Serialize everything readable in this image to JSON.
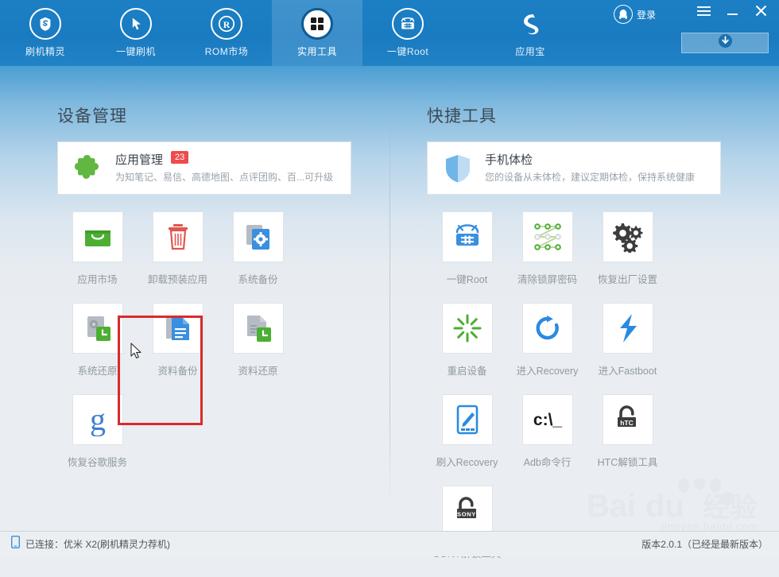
{
  "header": {
    "tabs": [
      {
        "label": "刷机精灵",
        "icon": "brand-s-icon",
        "active": false
      },
      {
        "label": "一键刷机",
        "icon": "cursor-arrow-icon",
        "active": false
      },
      {
        "label": "ROM市场",
        "icon": "registered-r-icon",
        "active": false
      },
      {
        "label": "实用工具",
        "icon": "grid-squares-icon",
        "active": true
      },
      {
        "label": "一键Root",
        "icon": "android-root-icon",
        "active": false
      },
      {
        "label": "应用宝",
        "icon": "yingyongbao-icon",
        "active": false
      }
    ],
    "login_label": "登录",
    "menu_icon": "hamburger-menu-icon",
    "minimize_icon": "minimize-icon",
    "close_icon": "close-icon",
    "download_icon": "download-arrow-icon",
    "accent_color": "#1a7bc0"
  },
  "left_panel": {
    "title": "设备管理",
    "feature_card": {
      "title": "应用管理",
      "badge": "23",
      "desc": "为知笔记、易信、高德地图、点评团购、百...可升级",
      "icon": "puzzle-piece-icon"
    },
    "tiles": [
      {
        "label": "应用市场",
        "icon": "shopping-bag-icon",
        "highlighted": false
      },
      {
        "label": "卸载预装应用",
        "icon": "trash-can-icon",
        "highlighted": false
      },
      {
        "label": "系统备份",
        "icon": "system-backup-icon",
        "highlighted": false
      },
      {
        "label": "系统还原",
        "icon": "system-restore-icon",
        "highlighted": false
      },
      {
        "label": "资料备份",
        "icon": "data-backup-icon",
        "highlighted": false
      },
      {
        "label": "资料还原",
        "icon": "data-restore-icon",
        "highlighted": true
      },
      {
        "label": "恢复谷歌服务",
        "icon": "google-g-icon",
        "highlighted": false
      }
    ]
  },
  "right_panel": {
    "title": "快捷工具",
    "feature_card": {
      "title": "手机体检",
      "badge": "",
      "desc": "您的设备从未体检，建议定期体检，保持系统健康",
      "icon": "shield-icon"
    },
    "tiles": [
      {
        "label": "一键Root",
        "icon": "android-root-icon"
      },
      {
        "label": "清除锁屏密码",
        "icon": "pattern-lock-icon"
      },
      {
        "label": "恢复出厂设置",
        "icon": "gears-icon"
      },
      {
        "label": "重启设备",
        "icon": "reboot-burst-icon"
      },
      {
        "label": "进入Recovery",
        "icon": "refresh-arrow-icon"
      },
      {
        "label": "进入Fastboot",
        "icon": "lightning-bolt-icon"
      },
      {
        "label": "刷入Recovery",
        "icon": "phone-pencil-icon"
      },
      {
        "label": "Adb命令行",
        "icon": "command-prompt-icon"
      },
      {
        "label": "HTC解锁工具",
        "icon": "htc-unlock-icon"
      },
      {
        "label": "SONY解锁工具",
        "icon": "sony-unlock-icon"
      }
    ]
  },
  "statusbar": {
    "device_icon": "phone-icon",
    "connection_text": "已连接：优米 X2(刷机精灵力荐机)",
    "version_text": "版本2.0.1（已经是最新版本）"
  },
  "watermark": {
    "brand": "Baidu经验",
    "url": "jingyan.baidu.com"
  },
  "colors": {
    "header_blue": "#1a7bc0",
    "badge_red": "#ef4b4b",
    "highlight_red": "#d92b2b",
    "tile_label": "#9099a2"
  }
}
